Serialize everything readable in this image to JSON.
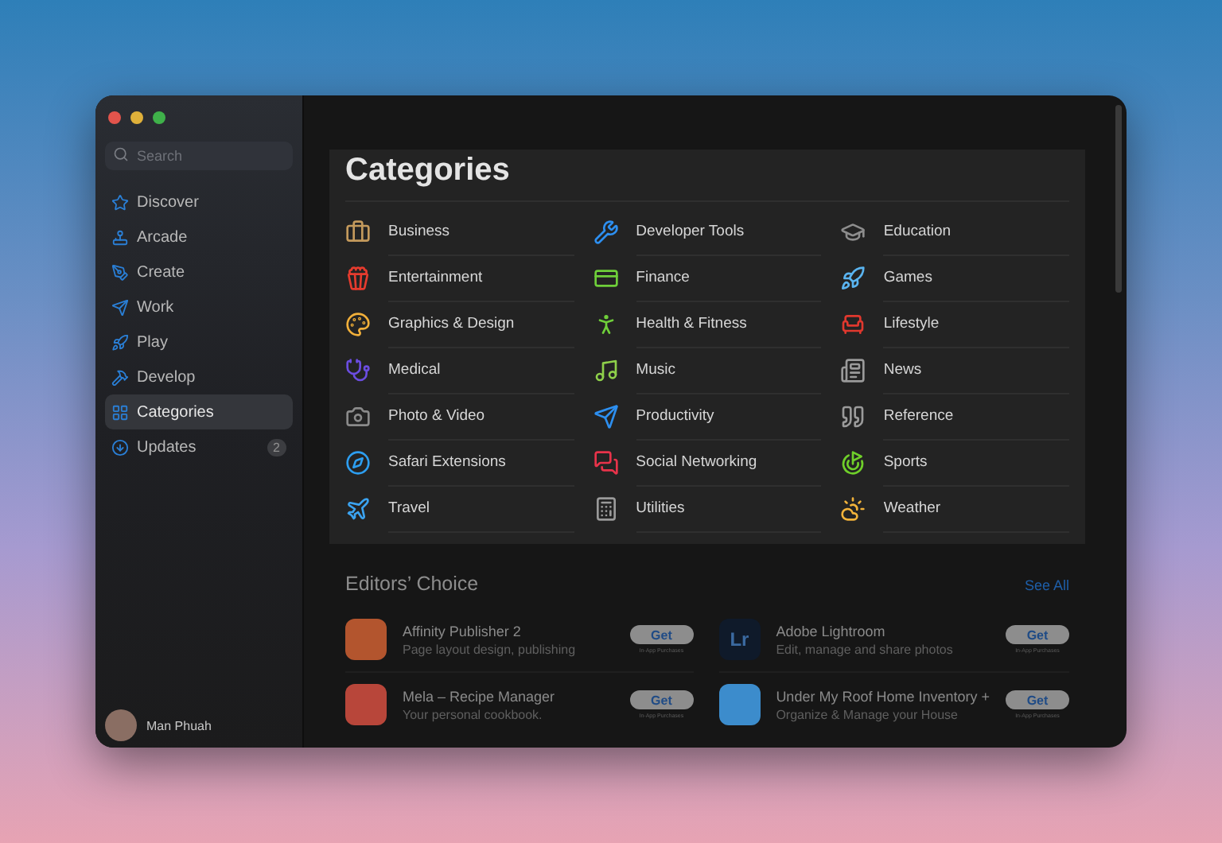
{
  "sidebar": {
    "search": {
      "placeholder": "Search"
    },
    "items": [
      {
        "label": "Discover",
        "selected": false
      },
      {
        "label": "Arcade",
        "selected": false
      },
      {
        "label": "Create",
        "selected": false
      },
      {
        "label": "Work",
        "selected": false
      },
      {
        "label": "Play",
        "selected": false
      },
      {
        "label": "Develop",
        "selected": false
      },
      {
        "label": "Categories",
        "selected": true
      },
      {
        "label": "Updates",
        "selected": false,
        "badge": "2"
      }
    ],
    "user": {
      "name": "Man Phuah"
    }
  },
  "categories": {
    "title": "Categories",
    "columns": [
      [
        {
          "label": "Business"
        },
        {
          "label": "Entertainment"
        },
        {
          "label": "Graphics & Design"
        },
        {
          "label": "Medical"
        },
        {
          "label": "Photo & Video"
        },
        {
          "label": "Safari Extensions"
        },
        {
          "label": "Travel"
        }
      ],
      [
        {
          "label": "Developer Tools"
        },
        {
          "label": "Finance"
        },
        {
          "label": "Health & Fitness"
        },
        {
          "label": "Music"
        },
        {
          "label": "Productivity"
        },
        {
          "label": "Social Networking"
        },
        {
          "label": "Utilities"
        }
      ],
      [
        {
          "label": "Education"
        },
        {
          "label": "Games"
        },
        {
          "label": "Lifestyle"
        },
        {
          "label": "News"
        },
        {
          "label": "Reference"
        },
        {
          "label": "Sports"
        },
        {
          "label": "Weather"
        }
      ]
    ]
  },
  "editors_choice": {
    "title": "Editors’ Choice",
    "link": "See All",
    "apps": [
      {
        "name": "Affinity Publisher 2",
        "subtitle": "Page layout design, publishing",
        "button": "Get",
        "note": "In-App Purchases"
      },
      {
        "name": "Adobe Lightroom",
        "subtitle": "Edit, manage and share photos",
        "button": "Get",
        "note": "In-App Purchases",
        "logo_text": "Lr"
      },
      {
        "name": "Mela – Recipe Manager",
        "subtitle": "Your personal cookbook.",
        "button": "Get",
        "note": "In-App Purchases"
      },
      {
        "name": "Under My Roof Home Inventory +",
        "subtitle": "Organize & Manage your House",
        "button": "Get",
        "note": "In-App Purchases"
      }
    ]
  }
}
